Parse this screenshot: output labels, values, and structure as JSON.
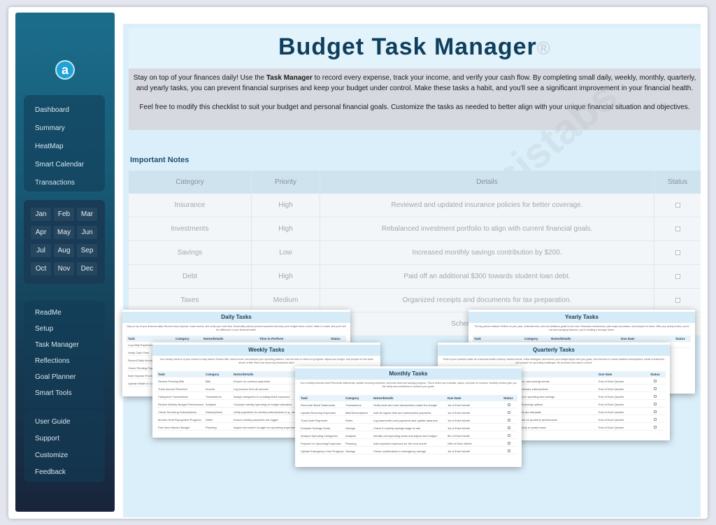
{
  "sidebar": {
    "logo_letter": "a",
    "main_nav": [
      "Dashboard",
      "Summary",
      "HeatMap",
      "Smart Calendar",
      "Transactions"
    ],
    "months": [
      "Jan",
      "Feb",
      "Mar",
      "Apr",
      "May",
      "Jun",
      "Jul",
      "Aug",
      "Sep",
      "Oct",
      "Nov",
      "Dec"
    ],
    "tools_nav": [
      "ReadMe",
      "Setup",
      "Task Manager",
      "Reflections",
      "Goal Planner",
      "Smart Tools"
    ],
    "help_nav": [
      "User Guide",
      "Support",
      "Customize",
      "Feedback"
    ]
  },
  "header": {
    "title": "Budget Task Manager",
    "trademark": "®",
    "intro_pre": "Stay on top of your finances daily! Use the ",
    "intro_bold": "Task Manager",
    "intro_post": " to record every expense, track your income, and verify your cash flow. By completing small daily, weekly, monthly, quarterly, and yearly tasks, you can prevent financial surprises and keep your budget under control. Make these tasks a habit, and you'll see a significant improvement in your financial health.",
    "intro_2": "Feel free to modify this checklist to suit your budget and personal financial goals. Customize the tasks as needed to better align with your unique financial situation and objectives."
  },
  "watermark": "analysistabs",
  "notes": {
    "title": "Important Notes",
    "columns": [
      "Category",
      "Priority",
      "Details",
      "Status"
    ],
    "rows": [
      {
        "category": "Insurance",
        "priority": "High",
        "details": "Reviewed and updated insurance policies for better coverage."
      },
      {
        "category": "Investments",
        "priority": "High",
        "details": "Rebalanced investment portfolio to align with current financial goals."
      },
      {
        "category": "Savings",
        "priority": "Low",
        "details": "Increased monthly savings contribution by $200."
      },
      {
        "category": "Debt",
        "priority": "High",
        "details": "Paid off an additional $300 towards student loan debt."
      },
      {
        "category": "Taxes",
        "priority": "Medium",
        "details": "Organized receipts and documents for tax preparation."
      },
      {
        "category": "",
        "priority": "",
        "details": "Scheduled major home"
      }
    ]
  },
  "cards": {
    "daily": {
      "title": "Daily Tasks",
      "desc": "Stay on top of your finances daily! Record every expense, track income, and verify your cash flow. Small daily actions prevent surprises and keep your budget under control. Make it a habit, and you'll see the difference in your financial health.",
      "columns": [
        "Task",
        "Category",
        "Notes/Details",
        "Time to Perform",
        "Status"
      ],
      "rows": [
        "Log Daily Expenses",
        "Verify Cash Flow",
        "Record Daily Income",
        "Check Pending Pay",
        "Note Impulse Purch",
        "Update Wallet or Ca"
      ]
    },
    "yearly": {
      "title": "Yearly Tasks",
      "desc": "The big picture matters! Reflect on your year, celebrate wins, and set ambitious goals for the next. Reassess investments, plan major purchases, and prepare for taxes. With your yearly review, you're not just managing finances, you're building a stronger future.",
      "columns": [
        "Task",
        "Category",
        "Notes/Details",
        "Due Date",
        "Status"
      ],
      "rows": [
        [
          "Year-End Summary",
          "Analysis",
          "Summarize the year's income, expenses, and savings",
          "End of December"
        ]
      ]
    },
    "weekly": {
      "title": "Weekly Tasks",
      "desc": "Your weekly check-in is your chance to stay ahead. Review bills, track income, and analyze your spending patterns. Use this time to reflect on progress, adjust your budget, and prepare for the week ahead. A little effort now saves big headaches later!",
      "columns": [
        "Task",
        "Category",
        "Notes/Details"
      ],
      "rows": [
        [
          "Review Pending Bills",
          "Bills",
          "Ensure no overdue payments"
        ],
        [
          "Track Income Received",
          "Income",
          "Log income from all sources"
        ],
        [
          "Categorize Transactions",
          "Transactions",
          "Assign categories to uncategorized expenses"
        ],
        [
          "Review Weekly Budget Performance",
          "Analysis",
          "Compare weekly spending vs budget allocation"
        ],
        [
          "Check Recurring Subscriptions",
          "Subscriptions",
          "Verify payments for weekly subscriptions (e.g., streaming)"
        ],
        [
          "Monitor Debt Repayment Progress",
          "Debts",
          "Ensure weekly payments are logged"
        ],
        [
          "Plan Next Week's Budget",
          "Planning",
          "Adjust next week's budget for upcoming expenses"
        ]
      ]
    },
    "quarterly": {
      "title": "Quarterly Tasks",
      "desc": "Think of your quarterly tasks as a financial health checkup. Assess trends, refine strategies, and ensure your budget aligns with your goals. Use this time to cancel wasteful subscriptions, tweak investments, and prepare for upcoming challenges. Be proactive and stay in control!",
      "columns": [
        "Due Date",
        "Status"
      ],
      "rows": [
        [
          "income, expenses, and savings trends",
          "End of Each Quarter"
        ],
        [
          "unused or unnecessary subscriptions",
          "End of Each Quarter"
        ],
        [
          "quarterly patterns in spending and savings",
          "End of Each Quarter"
        ],
        [
          "repayment or refinancing options",
          "End of Each Quarter"
        ],
        [
          "insurance policies are adequate",
          "End of Each Quarter"
        ],
        [
          "investments based on quarterly performance",
          "End of Each Quarter"
        ],
        [
          "records for quarterly or yearly taxes",
          "End of Each Quarter"
        ]
      ]
    },
    "monthly": {
      "title": "Monthly Tasks",
      "desc": "Your monthly financial reset! Reconcile statements, update recurring expenses, and track debt and savings progress. This is where you evaluate, adjust, and plan for success. Monthly reviews give you the clarity and confidence to achieve your goals.",
      "columns": [
        "Task",
        "Category",
        "Notes/Details",
        "Due Date",
        "Status"
      ],
      "rows": [
        [
          "Reconcile Bank Statements",
          "Transactions",
          "Verify bank and card transactions match the budget",
          "1st of Each Month"
        ],
        [
          "Update Recurring Expenses",
          "Bills/Subscriptions",
          "Add all regular bills and subscription payments",
          "1st of Each Month"
        ],
        [
          "Track Debt Payments",
          "Debts",
          "Log loan/credit card payments and update balances",
          "1st of Each Month"
        ],
        [
          "Evaluate Savings Goals",
          "Savings",
          "Check if monthly savings target is met",
          "1st of Each Month"
        ],
        [
          "Analyze Spending Categories",
          "Analysis",
          "Identify overspending areas and adjust next budget",
          "5th of Each Month"
        ],
        [
          "Prepare for Upcoming Expenses",
          "Planning",
          "Add expected expenses for the next month",
          "25th of Each Month"
        ],
        [
          "Update Emergency Fund Progress",
          "Savings",
          "Check contributions to emergency savings",
          "1st of Each Month"
        ]
      ]
    }
  }
}
